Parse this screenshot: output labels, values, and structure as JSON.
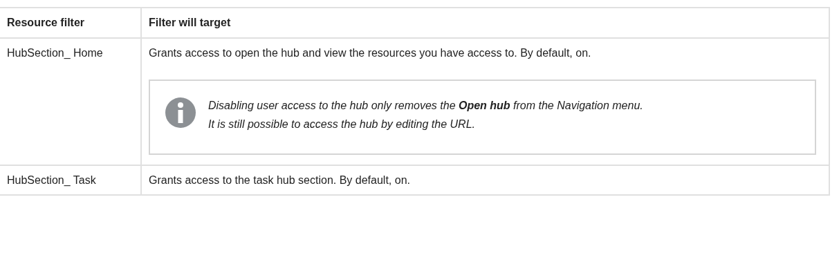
{
  "table": {
    "columns": [
      "Resource filter",
      "Filter will target"
    ],
    "rows": [
      {
        "filter": "HubSection_ Home",
        "description": "Grants access to open the hub and view the resources you have access to. By default, on.",
        "note": "Disabling user access to the hub only removes the **Open hub** from the Navigation menu. It is still possible to access the hub by editing the URL."
      },
      {
        "filter": "HubSection_ Task",
        "description": "Grants access to the task hub section. By default, on."
      }
    ]
  }
}
